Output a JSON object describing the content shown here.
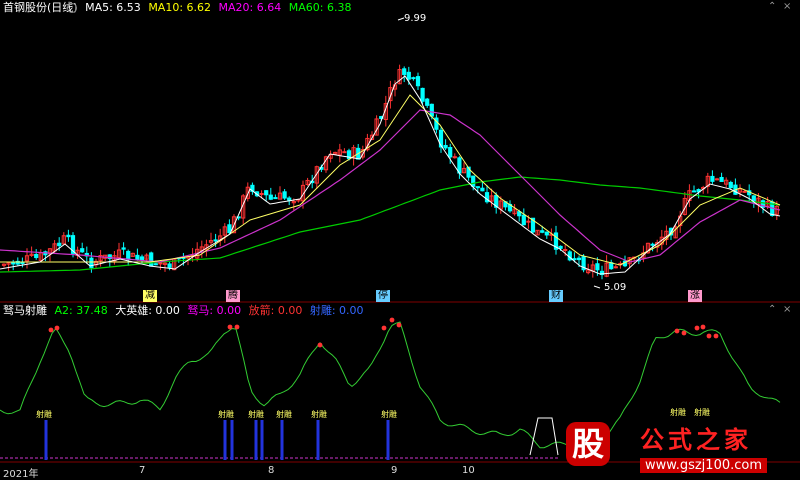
{
  "main_header": {
    "title": "首钢股份(日线)",
    "ma5": "MA5: 6.53",
    "ma10": "MA10: 6.62",
    "ma20": "MA20: 6.64",
    "ma60": "MA60: 6.38",
    "colors": {
      "title": "#ffffff",
      "ma5": "#ffffff",
      "ma10": "#ffff00",
      "ma20": "#ff00ff",
      "ma60": "#00ff00"
    }
  },
  "price_annotations": {
    "high": "9.99",
    "low": "5.09"
  },
  "markers": [
    {
      "text": "减",
      "bg": "#ffff66",
      "fg": "#000000"
    },
    {
      "text": "腾",
      "bg": "#ff99cc",
      "fg": "#000000"
    },
    {
      "text": "停",
      "bg": "#66ccff",
      "fg": "#000000"
    },
    {
      "text": "财",
      "bg": "#66ccff",
      "fg": "#000000"
    },
    {
      "text": "涨",
      "bg": "#ff99cc",
      "fg": "#000000"
    }
  ],
  "indicator_header": {
    "name": "驽马射雕",
    "a2": "A2: 37.48",
    "dyx": "大英雄: 0.00",
    "nm": "驽马: 0.00",
    "sj": "放箭: 0.00",
    "sd": "射雕: 0.00",
    "colors": {
      "name": "#ffffff",
      "a2": "#00ff00",
      "dyx": "#ffffff",
      "nm": "#ff00ff",
      "sj": "#ff3333",
      "sd": "#3366ff"
    }
  },
  "signal_label": "射雕",
  "time_axis": [
    "2021年",
    "7",
    "8",
    "9",
    "10"
  ],
  "watermark": {
    "glyph": "股",
    "brand": "公式之家",
    "url": "www.gszj100.com"
  },
  "colors": {
    "up": "#ff3333",
    "down": "#00ffff",
    "bg": "#000000",
    "grid": "#800000"
  }
}
